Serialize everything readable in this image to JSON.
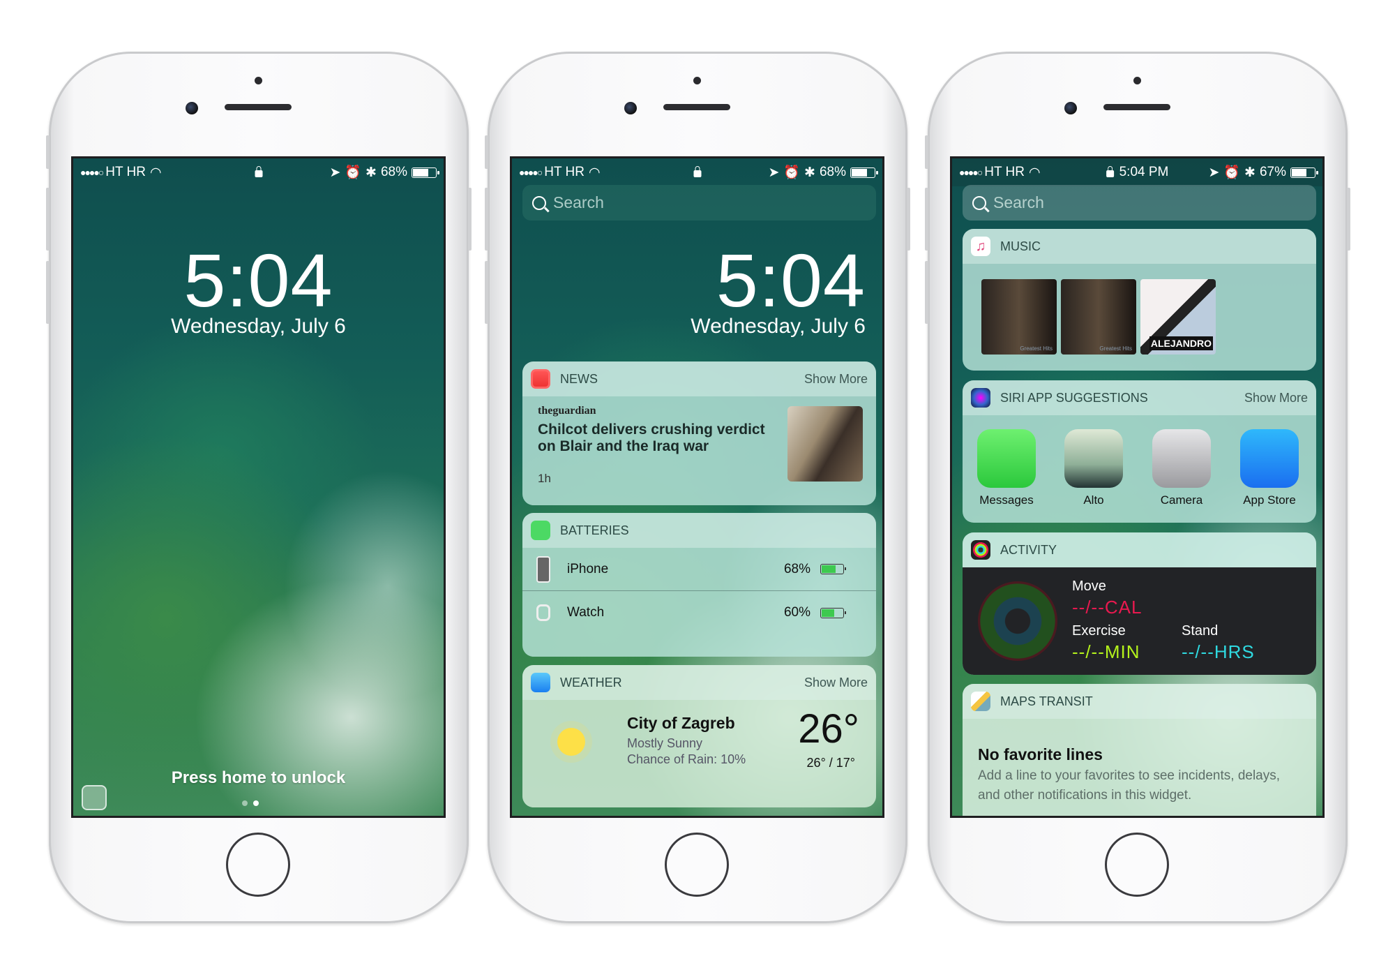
{
  "phones": [
    {
      "status": {
        "carrier": "HT HR",
        "battery": "68%",
        "battery_level": 0.68
      },
      "lock": {
        "time": "5:04",
        "date": "Wednesday, July 6",
        "hint": "Press home to unlock",
        "page": 1,
        "pages": 2
      }
    },
    {
      "status": {
        "carrier": "HT HR",
        "battery": "68%",
        "battery_level": 0.68
      },
      "search_placeholder": "Search",
      "time": "5:04",
      "date": "Wednesday, July 6",
      "news": {
        "title": "NEWS",
        "more": "Show More",
        "source": "theguardian",
        "headline": "Chilcot delivers crushing verdict on Blair and the Iraq war",
        "age": "1h"
      },
      "batteries": {
        "title": "BATTERIES",
        "devices": [
          {
            "name": "iPhone",
            "level": "68%",
            "fill": 0.68
          },
          {
            "name": "Watch",
            "level": "60%",
            "fill": 0.6
          }
        ]
      },
      "weather": {
        "title": "WEATHER",
        "more": "Show More",
        "city": "City of Zagreb",
        "condition": "Mostly Sunny",
        "rain": "Chance of Rain: 10%",
        "temp": "26°",
        "range": "26° / 17°"
      }
    },
    {
      "status": {
        "carrier": "HT HR",
        "time": "5:04 PM",
        "battery": "67%",
        "battery_level": 0.67
      },
      "search_placeholder": "Search",
      "music": {
        "title": "MUSIC",
        "albums": [
          {
            "label": "Greatest Hits"
          },
          {
            "label": "Greatest Hits"
          },
          {
            "label": "ALEJANDRO"
          }
        ]
      },
      "siri": {
        "title": "SIRI APP SUGGESTIONS",
        "more": "Show More",
        "apps": [
          "Messages",
          "Alto",
          "Camera",
          "App Store"
        ]
      },
      "activity": {
        "title": "ACTIVITY",
        "move_label": "Move",
        "move_value": "--/--CAL",
        "exercise_label": "Exercise",
        "exercise_value": "--/--MIN",
        "stand_label": "Stand",
        "stand_value": "--/--HRS",
        "colors": {
          "move": "#e8194f",
          "exercise": "#b4f21c",
          "stand": "#2fd9e0"
        }
      },
      "maps": {
        "title": "MAPS TRANSIT",
        "heading": "No favorite lines",
        "body": "Add a line to your favorites to see incidents, delays, and other notifications in this widget."
      }
    }
  ]
}
